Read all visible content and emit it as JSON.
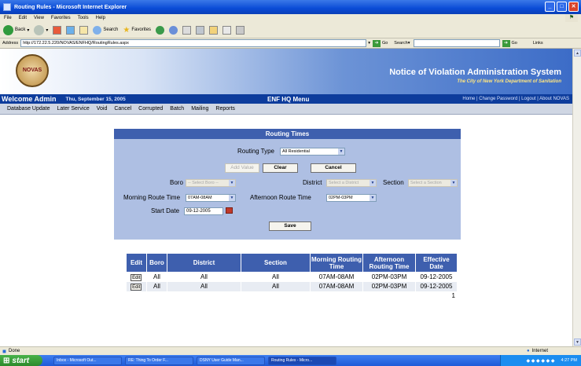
{
  "window": {
    "title": "Routing Rules - Microsoft Internet Explorer"
  },
  "menu": [
    "File",
    "Edit",
    "View",
    "Favorites",
    "Tools",
    "Help"
  ],
  "toolbar": {
    "back": "Back",
    "search": "Search",
    "favorites": "Favorites"
  },
  "address": {
    "label": "Address",
    "url": "http://172.22.5.220/NOVAS/ENFHQ/RoutingRules.aspx",
    "go": "Go",
    "search_label": "Search",
    "go2": "Go",
    "links": "Links"
  },
  "header": {
    "logo_text": "NOVAS",
    "system_name": "Notice of Violation Administration System",
    "subtitle": "The City of New York Department of Sanitation"
  },
  "bluebar": {
    "welcome": "Welcome Admin",
    "date": "Thu, September 15, 2005",
    "title": "ENF HQ Menu",
    "links": "Home | Change Password | Logout | About NOVAS"
  },
  "nav": [
    "Database Update",
    "Later Service",
    "Void",
    "Cancel",
    "Corrupted",
    "Batch",
    "Mailing",
    "Reports"
  ],
  "form": {
    "title": "Routing Times",
    "routing_type_label": "Routing Type",
    "routing_type_value": "All Residential",
    "add_value": "Add Value",
    "clear": "Clear",
    "cancel": "Cancel",
    "boro_label": "Boro",
    "boro_value": "-- Select Boro --",
    "district_label": "District",
    "district_value": "Select a District",
    "section_label": "Section",
    "section_value": "Select a Section",
    "morning_label": "Morning Route Time",
    "morning_value": "07AM-08AM",
    "afternoon_label": "Afternoon Route Time",
    "afternoon_value": "02PM-03PM",
    "start_label": "Start Date",
    "start_value": "09-12-2005",
    "save": "Save"
  },
  "grid": {
    "headers": [
      "Edit",
      "Boro",
      "District",
      "Section",
      "Morning Routing Time",
      "Afternoon Routing Time",
      "Effective Date"
    ],
    "rows": [
      [
        "Edit",
        "All",
        "All",
        "All",
        "07AM-08AM",
        "02PM-03PM",
        "09-12-2005"
      ],
      [
        "Edit",
        "All",
        "All",
        "All",
        "07AM-08AM",
        "02PM-03PM",
        "09-12-2005"
      ]
    ],
    "pager": "1"
  },
  "status": {
    "text": "Done",
    "zone": "Internet"
  },
  "taskbar": {
    "start": "start",
    "tasks": [
      "Inbox - Microsoft Out...",
      "RE: Thing To Order F...",
      "DSNY User Guide Man...",
      "Routing Rules - Micro..."
    ],
    "clock": "4:27 PM"
  },
  "colors": {
    "title_blue": "#0a4bd6",
    "panel": "#aebfe3",
    "panel_header": "#3e5fae",
    "bluebar": "#0d3c9c"
  }
}
